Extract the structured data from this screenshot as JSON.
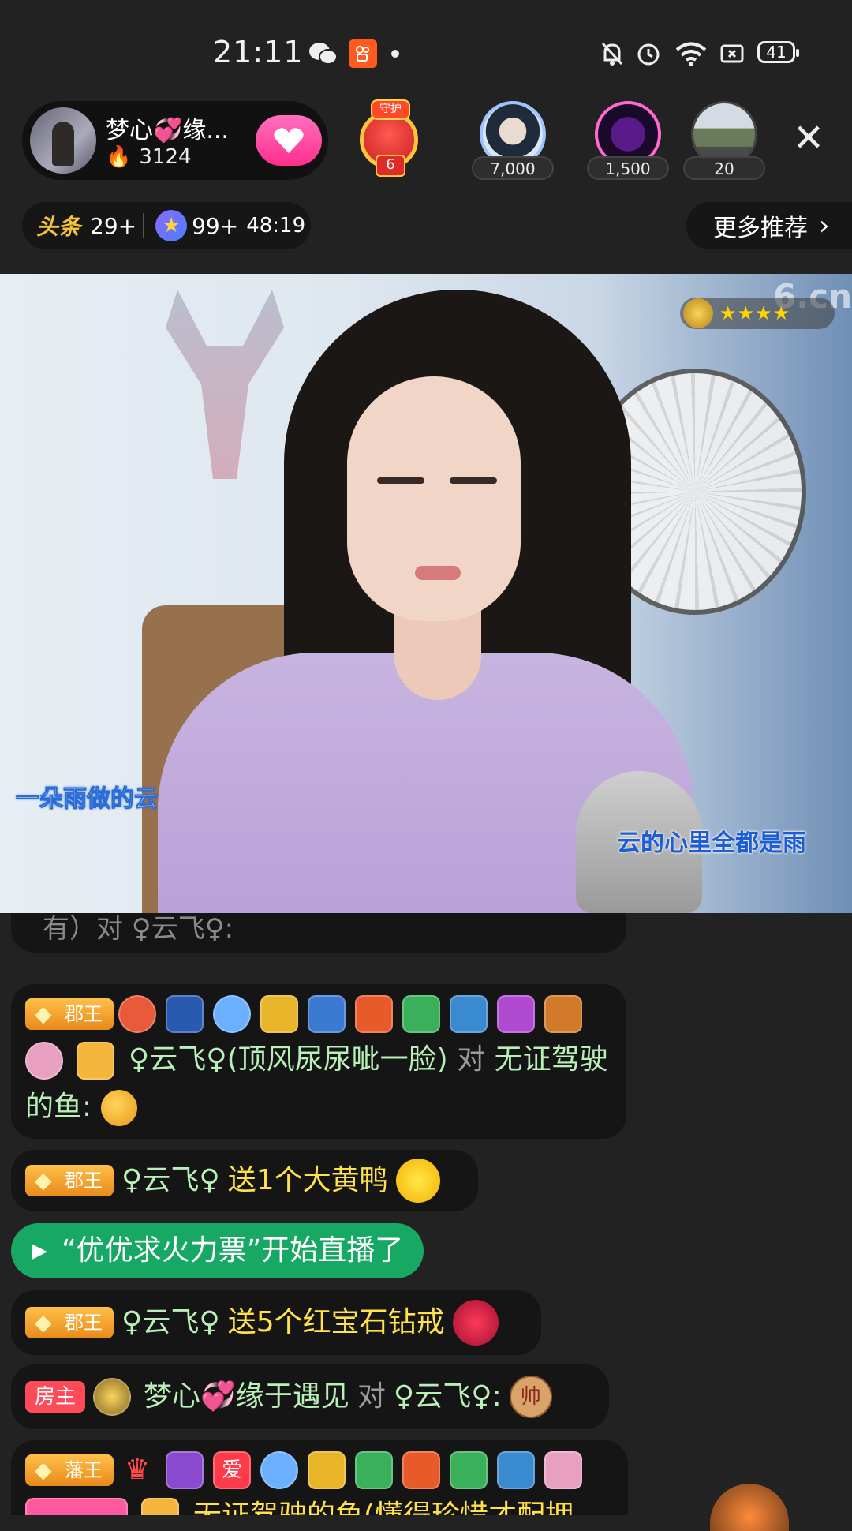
{
  "status_bar": {
    "time": "21:11",
    "battery": "41",
    "icons": [
      "wechat-icon",
      "kuaishou-icon",
      "dot-icon",
      "mute-bell-icon",
      "alarm-icon",
      "wifi-icon",
      "screen-cast-icon",
      "battery-icon"
    ]
  },
  "anchor": {
    "name": "梦心💞缘...",
    "heat": "3124",
    "follow_icon": "heart-icon"
  },
  "guard": {
    "top_label": "守护",
    "count": "6"
  },
  "viewers": [
    {
      "count": "7,000"
    },
    {
      "count": "1,500"
    },
    {
      "count": "20"
    }
  ],
  "close_label": "✕",
  "info_row": {
    "toutiao_label": "头条",
    "toutiao_count": "29+",
    "star_count": "99+",
    "timer": "48:19"
  },
  "more_recommend": {
    "label": "更多推荐",
    "chevron": "›"
  },
  "video": {
    "watermark": "6.cn",
    "level_stars": "★★★★",
    "caption_left": "一朵雨做的云",
    "caption_right": "云的心里全都是雨"
  },
  "chat": {
    "cut_off_text": "有）对 ♀云飞♀:",
    "messages": [
      {
        "tag": "郡王",
        "nick": "♀云飞♀(顶风尿尿呲一脸)",
        "verb": "对",
        "target": "无证驾驶的鱼:"
      },
      {
        "tag": "郡王",
        "nick": "♀云飞♀",
        "gift": "送1个大黄鸭"
      },
      {
        "tag": "郡王",
        "nick": "♀云飞♀",
        "gift": "送5个红宝石钻戒"
      },
      {
        "tag": "房主",
        "nick": "梦心💞缘于遇见",
        "verb": "对",
        "target": "♀云飞♀:",
        "emoji": "帅"
      },
      {
        "tag": "藩王",
        "love": "爱",
        "nick": "无证驾驶的鱼(懂得珍惜才配拥"
      }
    ],
    "live_notice": "“优优求火力票”开始直播了"
  },
  "colors": {
    "background": "#222222",
    "gift_text": "#ffe14a",
    "live_notice": "#17a864",
    "host_tag": "#ff4a5a",
    "follow_button": "#ff2e8c"
  }
}
